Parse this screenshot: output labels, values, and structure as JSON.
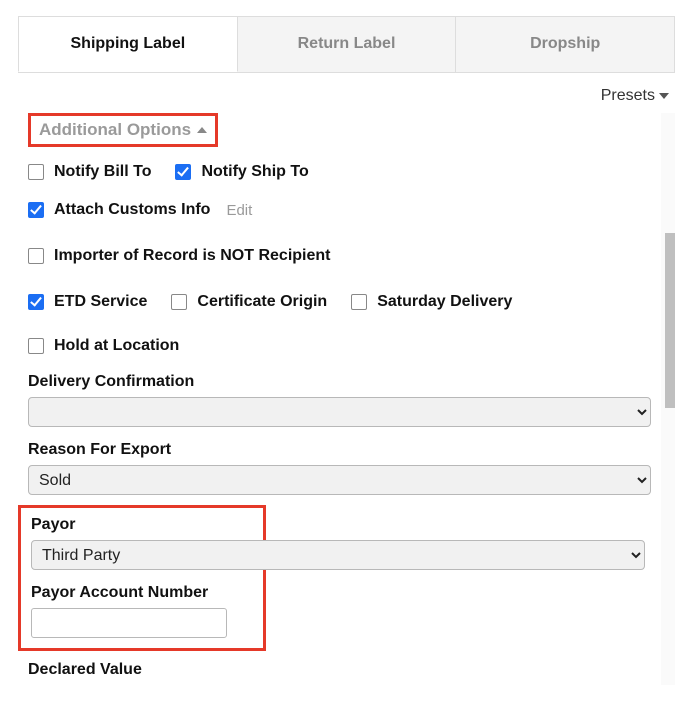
{
  "tabs": {
    "shipping": "Shipping Label",
    "return": "Return Label",
    "dropship": "Dropship"
  },
  "presets": {
    "label": "Presets"
  },
  "section": {
    "title": "Additional Options"
  },
  "checkboxes": {
    "notify_bill_to": "Notify Bill To",
    "notify_ship_to": "Notify Ship To",
    "attach_customs": "Attach Customs Info",
    "attach_customs_edit": "Edit",
    "importer_not_recipient": "Importer of Record is NOT Recipient",
    "etd_service": "ETD Service",
    "certificate_origin": "Certificate Origin",
    "saturday_delivery": "Saturday Delivery",
    "hold_at_location": "Hold at Location"
  },
  "fields": {
    "delivery_confirmation": {
      "label": "Delivery Confirmation",
      "value": ""
    },
    "reason_for_export": {
      "label": "Reason For Export",
      "value": "Sold"
    },
    "payor": {
      "label": "Payor",
      "value": "Third Party"
    },
    "payor_account_number": {
      "label": "Payor Account Number",
      "value": ""
    },
    "declared_value": {
      "label": "Declared Value"
    }
  }
}
